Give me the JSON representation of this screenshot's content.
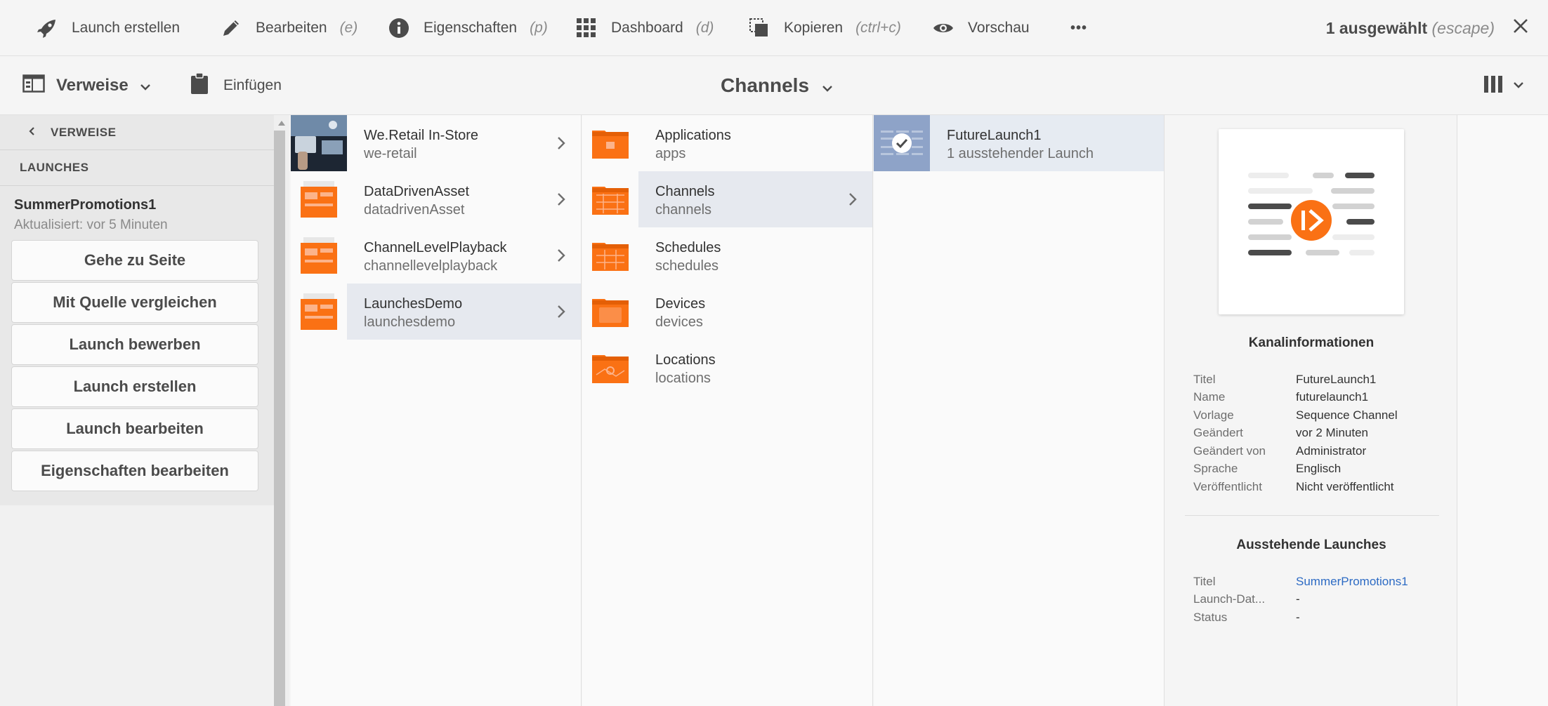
{
  "actionbar": {
    "create_launch": "Launch erstellen",
    "edit": "Bearbeiten",
    "edit_kbd": "(e)",
    "properties": "Eigenschaften",
    "properties_kbd": "(p)",
    "dashboard": "Dashboard",
    "dashboard_kbd": "(d)",
    "copy": "Kopieren",
    "copy_kbd": "(ctrl+c)",
    "preview": "Vorschau",
    "more": "•••",
    "selected": "1 ausgewählt",
    "selected_kbd": "(escape)"
  },
  "subheader": {
    "rail_toggle": "Verweise",
    "paste": "Einfügen",
    "title": "Channels"
  },
  "rail": {
    "back_label": "VERWEISE",
    "section_label": "LAUNCHES",
    "launch_name": "SummerPromotions1",
    "launch_updated": "Aktualisiert: vor 5 Minuten",
    "buttons": [
      "Gehe zu Seite",
      "Mit Quelle vergleichen",
      "Launch bewerben",
      "Launch erstellen",
      "Launch bearbeiten",
      "Eigenschaften bearbeiten"
    ]
  },
  "columns": {
    "col1": [
      {
        "title": "We.Retail In-Store",
        "name": "we-retail"
      },
      {
        "title": "DataDrivenAsset",
        "name": "datadrivenAsset"
      },
      {
        "title": "ChannelLevelPlayback",
        "name": "channellevelplayback"
      },
      {
        "title": "LaunchesDemo",
        "name": "launchesdemo"
      }
    ],
    "col2": [
      {
        "title": "Applications",
        "name": "apps"
      },
      {
        "title": "Channels",
        "name": "channels"
      },
      {
        "title": "Schedules",
        "name": "schedules"
      },
      {
        "title": "Devices",
        "name": "devices"
      },
      {
        "title": "Locations",
        "name": "locations"
      }
    ],
    "col3": [
      {
        "title": "FutureLaunch1",
        "name": "1 ausstehender Launch"
      }
    ]
  },
  "properties": {
    "channel_info_title": "Kanalinformationen",
    "channel_info": [
      {
        "k": "Titel",
        "v": "FutureLaunch1"
      },
      {
        "k": "Name",
        "v": "futurelaunch1"
      },
      {
        "k": "Vorlage",
        "v": "Sequence Channel"
      },
      {
        "k": "Geändert",
        "v": "vor 2 Minuten"
      },
      {
        "k": "Geändert von",
        "v": "Administrator"
      },
      {
        "k": "Sprache",
        "v": "Englisch"
      },
      {
        "k": "Veröffentlicht",
        "v": "Nicht veröffentlicht"
      }
    ],
    "pending_title": "Ausstehende Launches",
    "pending": [
      {
        "k": "Titel",
        "v": "SummerPromotions1"
      },
      {
        "k": "Launch-Dat...",
        "v": "-"
      },
      {
        "k": "Status",
        "v": "-"
      }
    ]
  },
  "colors": {
    "accent_orange": "#fa7114",
    "link_blue": "#2d6bc4",
    "selected_thumb": "#8ea3c8"
  },
  "icons": {
    "create_launch": "rocket-icon",
    "edit": "pencil-icon",
    "properties": "info-icon",
    "dashboard": "grid-icon",
    "copy": "copy-icon",
    "preview": "eye-icon",
    "close": "close-icon",
    "rail_toggle": "rail-icon",
    "paste": "clipboard-icon",
    "view_switch": "column-view-icon"
  }
}
